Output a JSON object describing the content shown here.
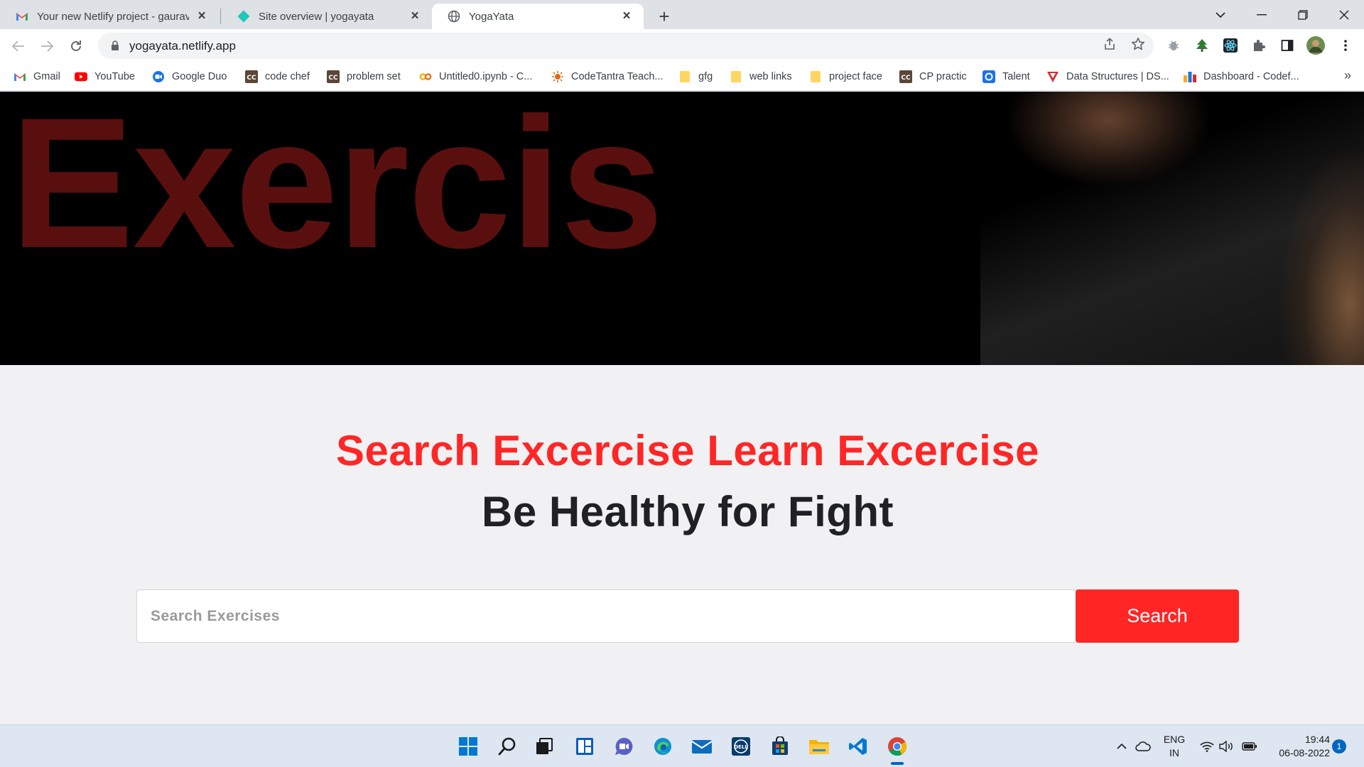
{
  "browser": {
    "tabs": [
      {
        "title": "Your new Netlify project - gaurav",
        "icon": "gmail-icon",
        "active": false
      },
      {
        "title": "Site overview | yogayata",
        "icon": "netlify-icon",
        "active": false
      },
      {
        "title": "YogaYata",
        "icon": "globe-icon",
        "active": true
      }
    ],
    "url": "yogayata.netlify.app",
    "bookmarks": [
      {
        "label": "Gmail",
        "icon": "gmail-icon"
      },
      {
        "label": "YouTube",
        "icon": "youtube-icon"
      },
      {
        "label": "Google Duo",
        "icon": "google-duo-icon"
      },
      {
        "label": "code chef",
        "icon": "codechef-icon"
      },
      {
        "label": "problem set",
        "icon": "codechef-icon"
      },
      {
        "label": "Untitled0.ipynb - C...",
        "icon": "colab-icon"
      },
      {
        "label": "CodeTantra Teach...",
        "icon": "codetantra-icon"
      },
      {
        "label": "gfg",
        "icon": "folder-icon"
      },
      {
        "label": "web links",
        "icon": "folder-icon"
      },
      {
        "label": "project face",
        "icon": "folder-icon"
      },
      {
        "label": "CP practic",
        "icon": "codechef-icon"
      },
      {
        "label": "Talent",
        "icon": "talent-icon"
      },
      {
        "label": "Data Structures | DS...",
        "icon": "ds-icon"
      },
      {
        "label": "Dashboard - Codef...",
        "icon": "codeforces-icon"
      }
    ],
    "bookmarks_more": "»"
  },
  "page": {
    "hero_word": "Exercis",
    "headline_primary": "Search Excercise Learn Excercise",
    "headline_secondary": "Be Healthy for Fight",
    "search": {
      "placeholder": "Search Exercises",
      "value": "",
      "button_label": "Search"
    },
    "colors": {
      "accent": "#ff2625",
      "hero_text": "#5a0f0f",
      "headline_dark": "#202124"
    }
  },
  "taskbar": {
    "apps": [
      "windows-start-icon",
      "search-icon",
      "task-view-icon",
      "widgets-icon",
      "teams-chat-icon",
      "edge-icon",
      "mail-icon",
      "dell-icon",
      "store-icon",
      "file-explorer-icon",
      "vscode-icon",
      "chrome-icon"
    ],
    "language_line1": "ENG",
    "language_line2": "IN",
    "time": "19:44",
    "date": "06-08-2022",
    "notification_count": "1"
  }
}
